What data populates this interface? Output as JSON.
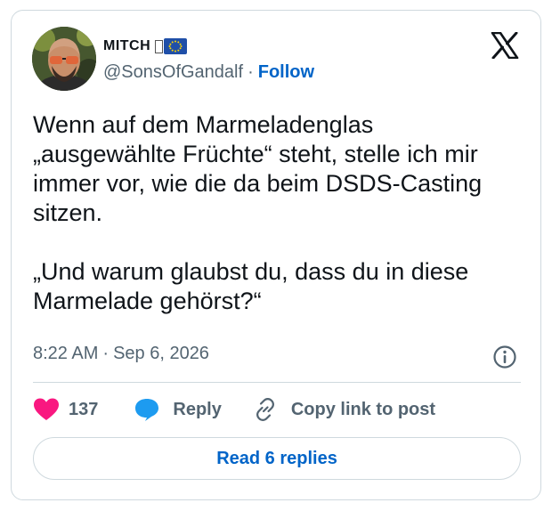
{
  "author": {
    "display_name": "MITCH",
    "handle": "@SonsOfGandalf",
    "separator": "·",
    "follow_label": "Follow",
    "avatar_icon": "profile-photo",
    "badges": [
      "pin-glyph",
      "eu-flag"
    ]
  },
  "brand": {
    "logo_icon": "x-logo",
    "accent_color": "#0064c8",
    "like_color": "#f91880",
    "reply_color": "#1d9bf0"
  },
  "tweet": {
    "paragraphs": [
      "Wenn auf dem Marmeladenglas „ausgewählte Früchte“ steht, stelle ich mir immer vor, wie die da beim DSDS-Casting sitzen.",
      "„Und warum glaubst du, dass du in diese Marmelade gehörst?“"
    ],
    "time": "8:22 AM",
    "date_separator": "·",
    "date": "Sep 6, 2026",
    "info_icon": "info-icon"
  },
  "actions": {
    "like_count": "137",
    "reply_label": "Reply",
    "copy_label": "Copy link to post"
  },
  "footer": {
    "read_replies_label": "Read 6 replies"
  }
}
